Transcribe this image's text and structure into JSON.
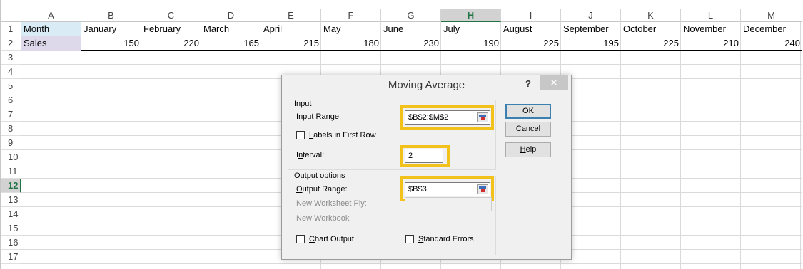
{
  "spreadsheet": {
    "columns": [
      "A",
      "B",
      "C",
      "D",
      "E",
      "F",
      "G",
      "H",
      "I",
      "J",
      "K",
      "L",
      "M"
    ],
    "selected_column": "H",
    "rows": [
      "1",
      "2",
      "3",
      "4",
      "5",
      "6",
      "7",
      "8",
      "9",
      "10",
      "11",
      "12",
      "13",
      "14",
      "15",
      "16",
      "17"
    ],
    "selected_row": "12",
    "row1": [
      "Month",
      "January",
      "February",
      "March",
      "April",
      "May",
      "June",
      "July",
      "August",
      "September",
      "October",
      "November",
      "December"
    ],
    "row2_label": "Sales",
    "row2_values": [
      "150",
      "220",
      "165",
      "215",
      "180",
      "230",
      "190",
      "225",
      "195",
      "225",
      "210",
      "240"
    ]
  },
  "dialog": {
    "title": "Moving Average",
    "help": "?",
    "close": "✕",
    "input_group": "Input",
    "input_range_label": "Input Range:",
    "input_range_value": "$B$2:$M$2",
    "labels_first_row": "Labels in First Row",
    "interval_label": "Interval:",
    "interval_value": "2",
    "output_group": "Output options",
    "output_range_label": "Output Range:",
    "output_range_value": "$B$3",
    "new_worksheet_ply": "New Worksheet Ply:",
    "new_workbook": "New Workbook",
    "chart_output": "Chart Output",
    "standard_errors": "Standard Errors",
    "ok": "OK",
    "cancel": "Cancel",
    "help_button": "Help"
  },
  "colors": {
    "highlight": "#f2c21a",
    "excel_green": "#217346"
  }
}
